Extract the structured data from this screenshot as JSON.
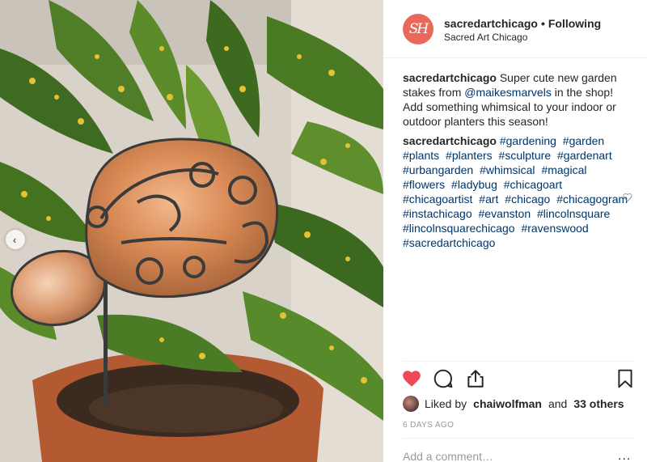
{
  "post": {
    "username": "sacredartchicago",
    "follow_separator": "•",
    "follow_status": "Following",
    "subtitle": "Sacred Art Chicago",
    "avatar_letters": "SH"
  },
  "caption": {
    "author": "sacredartchicago",
    "text_before": "Super cute new garden stakes from",
    "mention": "@maikesmarvels",
    "text_after": "in the shop! Add something whimsical to your indoor or outdoor planters this season!",
    "tags_author": "sacredartchicago",
    "hashtags": [
      "#gardening",
      "#garden",
      "#plants",
      "#planters",
      "#sculpture",
      "#gardenart",
      "#urbangarden",
      "#whimsical",
      "#magical",
      "#flowers",
      "#ladybug",
      "#chicagoart",
      "#chicagoartist",
      "#art",
      "#chicago",
      "#chicagogram",
      "#instachicago",
      "#evanston",
      "#lincolnsquare",
      "#lincolnsquarechicago",
      "#ravenswood",
      "#sacredartchicago"
    ]
  },
  "likes": {
    "prefix": "Liked by",
    "user": "chaiwolfman",
    "joiner": "and",
    "others": "33 others"
  },
  "time_ago": "6 DAYS AGO",
  "comment": {
    "placeholder": "Add a comment…",
    "more": "..."
  },
  "icons": {
    "like": "heart-filled-icon",
    "comment": "comment-icon",
    "share": "share-icon",
    "save": "bookmark-icon",
    "carousel_prev": "chevron-left-icon"
  },
  "colors": {
    "like_red": "#ed4956",
    "link_blue": "#003569",
    "avatar_bg": "#e8695a"
  }
}
